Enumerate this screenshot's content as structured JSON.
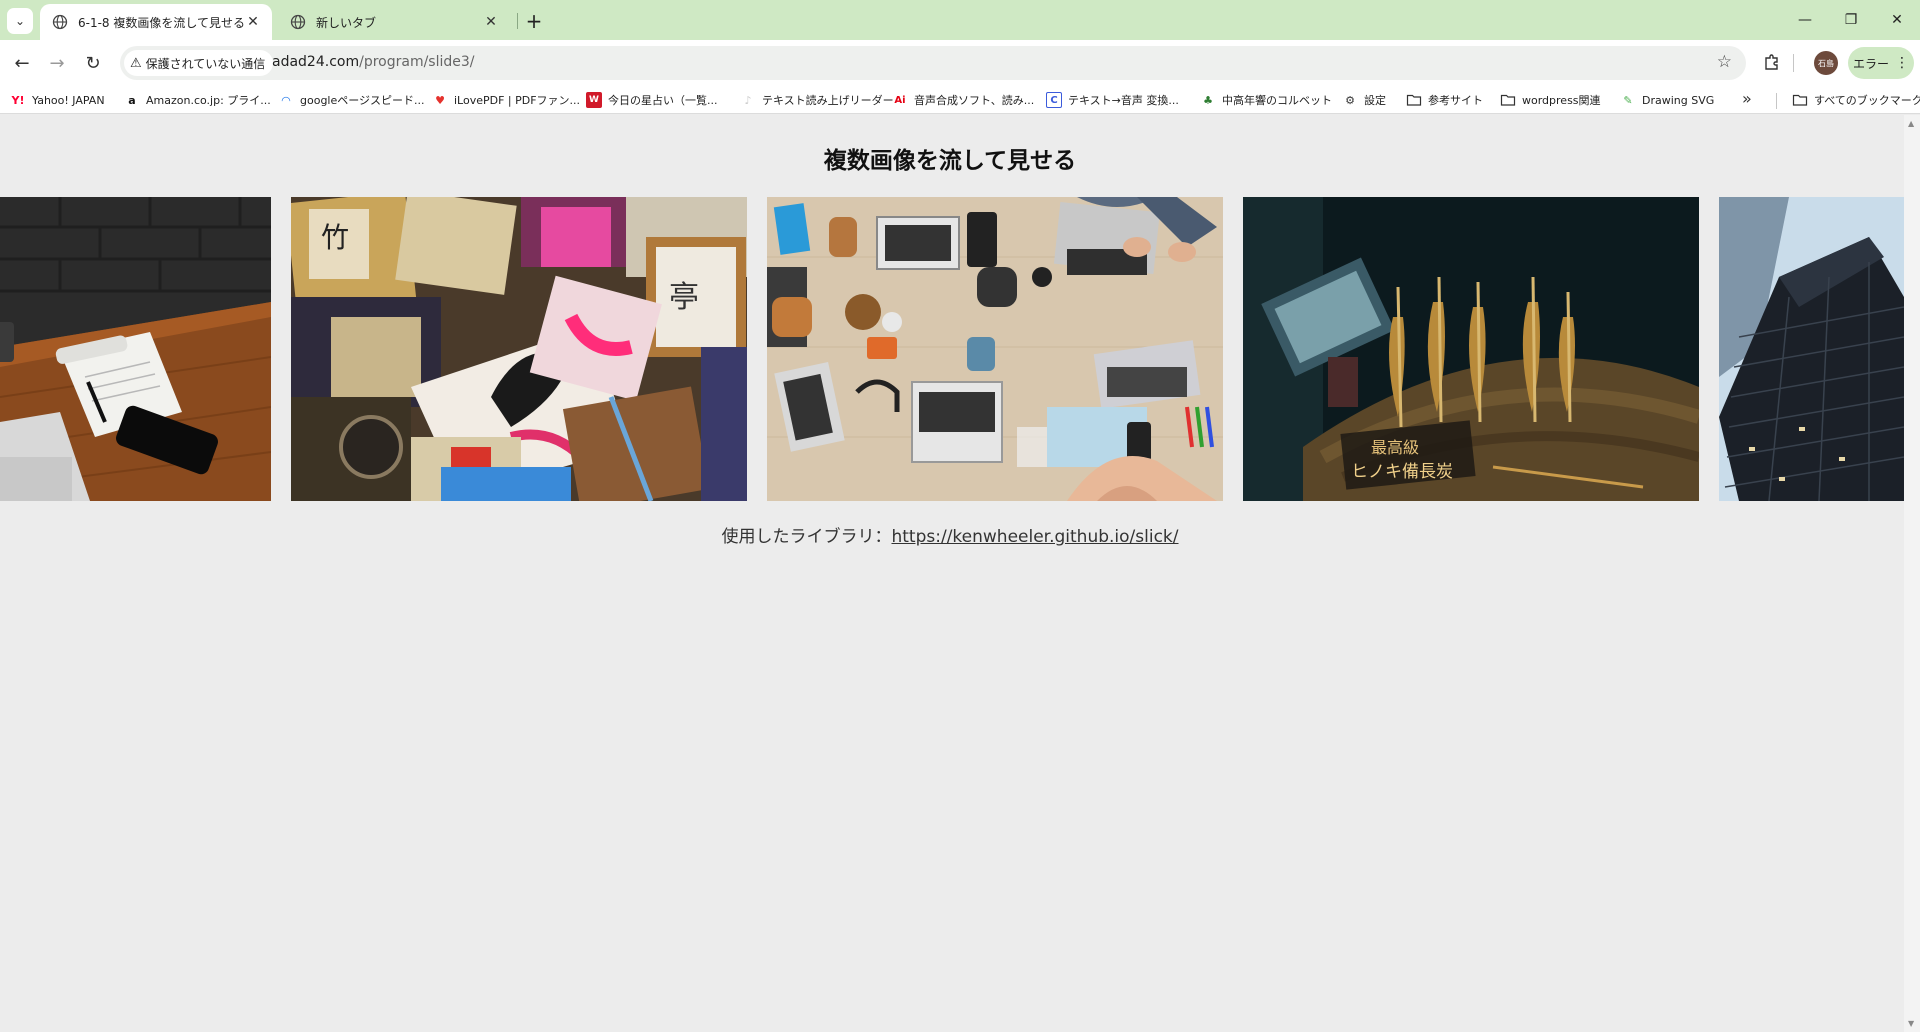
{
  "browser": {
    "tabs": [
      {
        "title": "6-1-8 複数画像を流して見せる",
        "active": true
      },
      {
        "title": "新しいタブ",
        "active": false
      }
    ],
    "new_tab_symbol": "+",
    "security_label": "保護されていない通信",
    "url_host": "adad24.com",
    "url_path": "/program/slide3/",
    "profile_initials": "石島",
    "error_chip_label": "エラー"
  },
  "bookmarks": [
    {
      "label": "Yahoo! JAPAN",
      "icon": "yahoo-icon",
      "color": "#ff0033"
    },
    {
      "label": "Amazon.co.jp: プライ...",
      "icon": "amazon-icon",
      "color": "#111111"
    },
    {
      "label": "googleページスピード...",
      "icon": "pagespeed-icon",
      "color": "#1a73e8"
    },
    {
      "label": "iLovePDF | PDFファン...",
      "icon": "heart-icon",
      "color": "#e5322d"
    },
    {
      "label": "今日の星占い（一覧...",
      "icon": "horoscope-icon",
      "color": "#d11a2a"
    },
    {
      "label": "テキスト読み上げリーダー",
      "icon": "speaker-icon",
      "color": "#cccccc"
    },
    {
      "label": "音声合成ソフト、読み...",
      "icon": "ai-voice-icon",
      "color": "#e60012"
    },
    {
      "label": "テキスト→音声 変換...",
      "icon": "convert-icon",
      "color": "#3b5bdb"
    },
    {
      "label": "中高年響のコルベット",
      "icon": "frog-icon",
      "color": "#2e7d32"
    },
    {
      "label": "設定",
      "icon": "gear-icon",
      "color": "#333333"
    },
    {
      "label": "参考サイト",
      "icon": "folder-icon",
      "color": "#333333"
    },
    {
      "label": "wordpress関連",
      "icon": "folder-icon",
      "color": "#333333"
    },
    {
      "label": "Drawing SVG",
      "icon": "drawing-svg-icon",
      "color": "#4caf50"
    }
  ],
  "bookmarks_more": "»",
  "all_bookmarks_label": "すべてのブックマーク",
  "page": {
    "title": "複数画像を流して見せる",
    "library_prefix": "使用したライブラリ：",
    "library_link": "https://kenwheeler.github.io/slick/"
  },
  "slides": [
    {
      "subject": "desk-notepad-phone-photo"
    },
    {
      "subject": "old-books-magazines-photo"
    },
    {
      "subject": "laptops-teamwork-table-photo"
    },
    {
      "subject": "grilled-fish-skewers-photo",
      "sign_lines": [
        "最高級",
        "ヒノキ備長炭"
      ]
    },
    {
      "subject": "skyscraper-photo"
    }
  ]
}
